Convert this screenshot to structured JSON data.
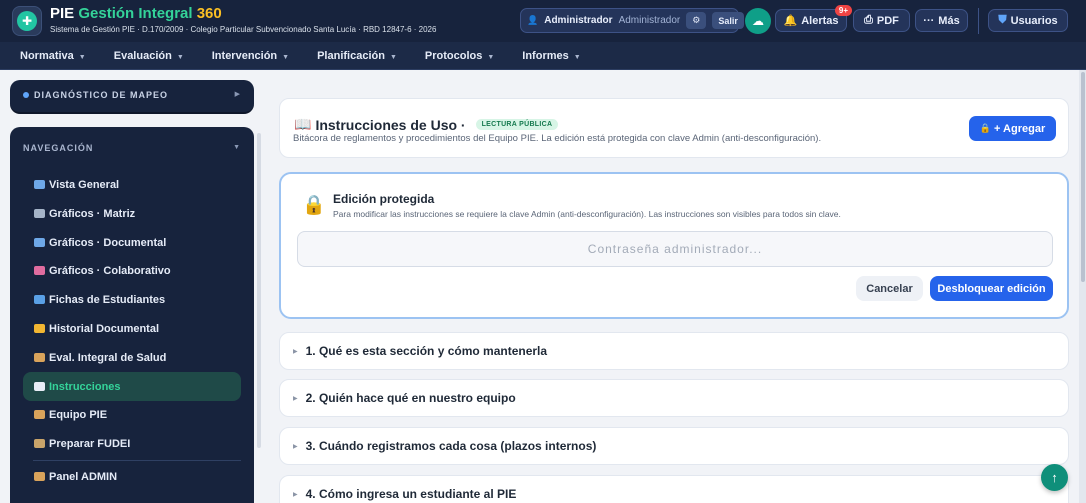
{
  "header": {
    "brand_pie": "PIE",
    "brand_gestion": "Gestión Integral",
    "brand_360": "360",
    "subtitle": "Sistema de Gestión PIE · D.170/2009 · Colegio Particular Subvencionado Santa Lucía · RBD 12847-6 · 2026",
    "user_name": "Administrador",
    "user_role": "Administrador",
    "logout_label": "Salir",
    "alerts_label": "Alertas",
    "alerts_badge": "9+",
    "pdf_label": "PDF",
    "more_label": "Más",
    "users_label": "Usuarios"
  },
  "nav": {
    "items": [
      {
        "label": "Normativa"
      },
      {
        "label": "Evaluación"
      },
      {
        "label": "Intervención"
      },
      {
        "label": "Planificación"
      },
      {
        "label": "Protocolos"
      },
      {
        "label": "Informes"
      }
    ]
  },
  "sidebar": {
    "diag_label": "DIAGNÓSTICO DE MAPEO",
    "nav_heading": "NAVEGACIÓN",
    "items": [
      {
        "label": "Vista General",
        "icon": "chart-bar-icon",
        "icon_color": "#6ea8e8"
      },
      {
        "label": "Gráficos · Matriz",
        "icon": "chart-line-icon",
        "icon_color": "#a5b4c8"
      },
      {
        "label": "Gráficos · Documental",
        "icon": "chart-bar-icon",
        "icon_color": "#6ea8e8"
      },
      {
        "label": "Gráficos · Colaborativo",
        "icon": "chart-down-icon",
        "icon_color": "#e06c9f"
      },
      {
        "label": "Fichas de Estudiantes",
        "icon": "id-card-icon",
        "icon_color": "#5aa0e6"
      },
      {
        "label": "Historial Documental",
        "icon": "folder-icon",
        "icon_color": "#f2b632"
      },
      {
        "label": "Eval. Integral de Salud",
        "icon": "person-icon",
        "icon_color": "#d9a35b"
      },
      {
        "label": "Instrucciones",
        "icon": "book-icon",
        "icon_color": "#e8eef7",
        "active": true
      },
      {
        "label": "Equipo PIE",
        "icon": "person-icon",
        "icon_color": "#d9a35b"
      },
      {
        "label": "Preparar FUDEI",
        "icon": "clipboard-icon",
        "icon_color": "#c9a46a"
      }
    ],
    "admin_label": "Panel ADMIN",
    "admin_icon_color": "#d9a35b"
  },
  "main": {
    "title": "Instrucciones de Uso ·",
    "public_badge": "LECTURA PÚBLICA",
    "subtitle": "Bitácora de reglamentos y procedimientos del Equipo PIE. La edición está protegida con clave Admin (anti-desconfiguración).",
    "add_label": "+ Agregar",
    "lock": {
      "title": "Edición protegida",
      "subtitle": "Para modificar las instrucciones se requiere la clave Admin (anti-desconfiguración). Las instrucciones son visibles para todos sin clave.",
      "password_placeholder": "Contraseña administrador...",
      "cancel_label": "Cancelar",
      "unlock_label": "Desbloquear edición"
    },
    "sections": [
      {
        "label": "1. Qué es esta sección y cómo mantenerla"
      },
      {
        "label": "2. Quién hace qué en nuestro equipo"
      },
      {
        "label": "3. Cuándo registramos cada cosa (plazos internos)"
      },
      {
        "label": "4. Cómo ingresa un estudiante al PIE"
      }
    ]
  },
  "colors": {
    "header_bg": "#17233d",
    "brand_green": "#34d399",
    "brand_yellow": "#fbbf24",
    "primary_blue": "#2563eb",
    "active_green": "#34d399"
  }
}
